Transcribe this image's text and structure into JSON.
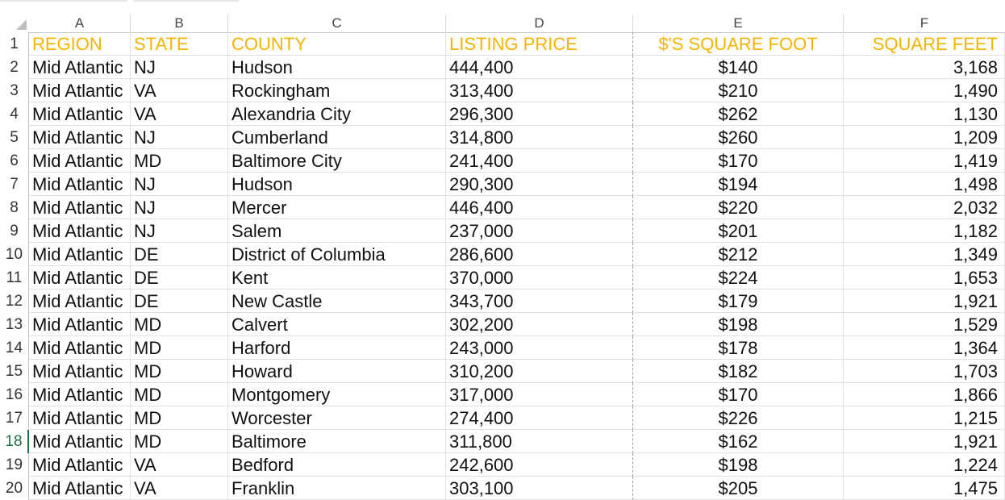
{
  "columns": [
    "A",
    "B",
    "C",
    "D",
    "E",
    "F"
  ],
  "header_row": {
    "row_number": "1",
    "region": "REGION",
    "state": "STATE",
    "county": "COUNTY",
    "listing_price": "LISTING PRICE",
    "price_per_sqft": "$'S SQUARE FOOT",
    "square_feet": "SQUARE FEET"
  },
  "rows": [
    {
      "row": "2",
      "region": "Mid Atlantic",
      "state": "NJ",
      "county": "Hudson",
      "price": "444,400",
      "ppsf": "$140",
      "sqft": "3,168"
    },
    {
      "row": "3",
      "region": "Mid Atlantic",
      "state": "VA",
      "county": "Rockingham",
      "price": "313,400",
      "ppsf": "$210",
      "sqft": "1,490"
    },
    {
      "row": "4",
      "region": "Mid Atlantic",
      "state": "VA",
      "county": "Alexandria City",
      "price": "296,300",
      "ppsf": "$262",
      "sqft": "1,130"
    },
    {
      "row": "5",
      "region": "Mid Atlantic",
      "state": "NJ",
      "county": "Cumberland",
      "price": "314,800",
      "ppsf": "$260",
      "sqft": "1,209"
    },
    {
      "row": "6",
      "region": "Mid Atlantic",
      "state": "MD",
      "county": "Baltimore City",
      "price": "241,400",
      "ppsf": "$170",
      "sqft": "1,419"
    },
    {
      "row": "7",
      "region": "Mid Atlantic",
      "state": "NJ",
      "county": "Hudson",
      "price": "290,300",
      "ppsf": "$194",
      "sqft": "1,498"
    },
    {
      "row": "8",
      "region": "Mid Atlantic",
      "state": "NJ",
      "county": "Mercer",
      "price": "446,400",
      "ppsf": "$220",
      "sqft": "2,032"
    },
    {
      "row": "9",
      "region": "Mid Atlantic",
      "state": "NJ",
      "county": "Salem",
      "price": "237,000",
      "ppsf": "$201",
      "sqft": "1,182"
    },
    {
      "row": "10",
      "region": "Mid Atlantic",
      "state": "DE",
      "county": "District of Columbia",
      "price": "286,600",
      "ppsf": "$212",
      "sqft": "1,349"
    },
    {
      "row": "11",
      "region": "Mid Atlantic",
      "state": "DE",
      "county": "Kent",
      "price": "370,000",
      "ppsf": "$224",
      "sqft": "1,653"
    },
    {
      "row": "12",
      "region": "Mid Atlantic",
      "state": "DE",
      "county": "New Castle",
      "price": "343,700",
      "ppsf": "$179",
      "sqft": "1,921"
    },
    {
      "row": "13",
      "region": "Mid Atlantic",
      "state": "MD",
      "county": "Calvert",
      "price": "302,200",
      "ppsf": "$198",
      "sqft": "1,529"
    },
    {
      "row": "14",
      "region": "Mid Atlantic",
      "state": "MD",
      "county": "Harford",
      "price": "243,000",
      "ppsf": "$178",
      "sqft": "1,364"
    },
    {
      "row": "15",
      "region": "Mid Atlantic",
      "state": "MD",
      "county": "Howard",
      "price": "310,200",
      "ppsf": "$182",
      "sqft": "1,703"
    },
    {
      "row": "16",
      "region": "Mid Atlantic",
      "state": "MD",
      "county": "Montgomery",
      "price": "317,000",
      "ppsf": "$170",
      "sqft": "1,866"
    },
    {
      "row": "17",
      "region": "Mid Atlantic",
      "state": "MD",
      "county": "Worcester",
      "price": "274,400",
      "ppsf": "$226",
      "sqft": "1,215"
    },
    {
      "row": "18",
      "region": "Mid Atlantic",
      "state": "MD",
      "county": "Baltimore",
      "price": "311,800",
      "ppsf": "$162",
      "sqft": "1,921"
    },
    {
      "row": "19",
      "region": "Mid Atlantic",
      "state": "VA",
      "county": "Bedford",
      "price": "242,600",
      "ppsf": "$198",
      "sqft": "1,224"
    },
    {
      "row": "20",
      "region": "Mid Atlantic",
      "state": "VA",
      "county": "Franklin",
      "price": "303,100",
      "ppsf": "$205",
      "sqft": "1,475"
    }
  ],
  "active_row": "18",
  "colors": {
    "header_text": "#f5b400",
    "active_row_marker": "#217346"
  }
}
